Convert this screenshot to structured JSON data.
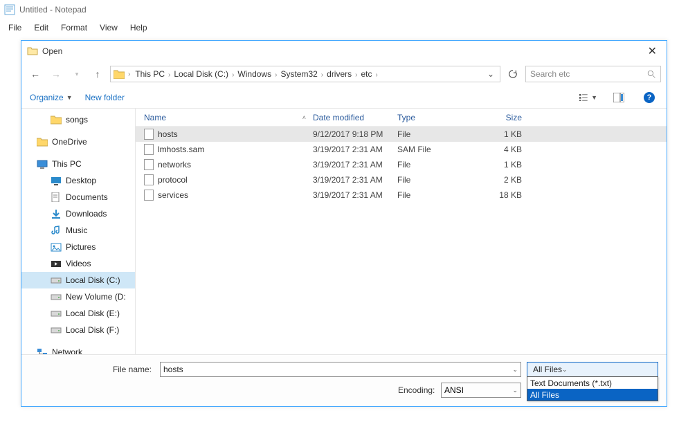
{
  "notepad": {
    "title": "Untitled - Notepad",
    "menu": {
      "file": "File",
      "edit": "Edit",
      "format": "Format",
      "view": "View",
      "help": "Help"
    }
  },
  "dialog": {
    "title": "Open",
    "breadcrumb": [
      "This PC",
      "Local Disk (C:)",
      "Windows",
      "System32",
      "drivers",
      "etc"
    ],
    "search_placeholder": "Search etc",
    "toolbar": {
      "organize": "Organize",
      "newfolder": "New folder"
    },
    "tree": [
      {
        "label": "songs",
        "icon": "folder",
        "indent": true
      },
      {
        "label": "OneDrive",
        "icon": "folder",
        "indent": false
      },
      {
        "label": "This PC",
        "icon": "pc",
        "indent": false
      },
      {
        "label": "Desktop",
        "icon": "desktop",
        "indent": true
      },
      {
        "label": "Documents",
        "icon": "doc",
        "indent": true
      },
      {
        "label": "Downloads",
        "icon": "download",
        "indent": true
      },
      {
        "label": "Music",
        "icon": "music",
        "indent": true
      },
      {
        "label": "Pictures",
        "icon": "picture",
        "indent": true
      },
      {
        "label": "Videos",
        "icon": "video",
        "indent": true
      },
      {
        "label": "Local Disk (C:)",
        "icon": "disk",
        "indent": true,
        "selected": true
      },
      {
        "label": "New Volume (D:",
        "icon": "disk",
        "indent": true
      },
      {
        "label": "Local Disk (E:)",
        "icon": "disk",
        "indent": true
      },
      {
        "label": "Local Disk (F:)",
        "icon": "disk",
        "indent": true
      },
      {
        "label": "Network",
        "icon": "network",
        "indent": false
      }
    ],
    "columns": {
      "name": "Name",
      "date": "Date modified",
      "type": "Type",
      "size": "Size"
    },
    "files": [
      {
        "name": "hosts",
        "date": "9/12/2017 9:18 PM",
        "type": "File",
        "size": "1 KB",
        "selected": true
      },
      {
        "name": "lmhosts.sam",
        "date": "3/19/2017 2:31 AM",
        "type": "SAM File",
        "size": "4 KB"
      },
      {
        "name": "networks",
        "date": "3/19/2017 2:31 AM",
        "type": "File",
        "size": "1 KB"
      },
      {
        "name": "protocol",
        "date": "3/19/2017 2:31 AM",
        "type": "File",
        "size": "2 KB"
      },
      {
        "name": "services",
        "date": "3/19/2017 2:31 AM",
        "type": "File",
        "size": "18 KB"
      }
    ],
    "filename_label": "File name:",
    "filename_value": "hosts",
    "filetype_selected": "All Files",
    "filetype_options": [
      "Text Documents (*.txt)",
      "All Files"
    ],
    "encoding_label": "Encoding:",
    "encoding_value": "ANSI"
  }
}
